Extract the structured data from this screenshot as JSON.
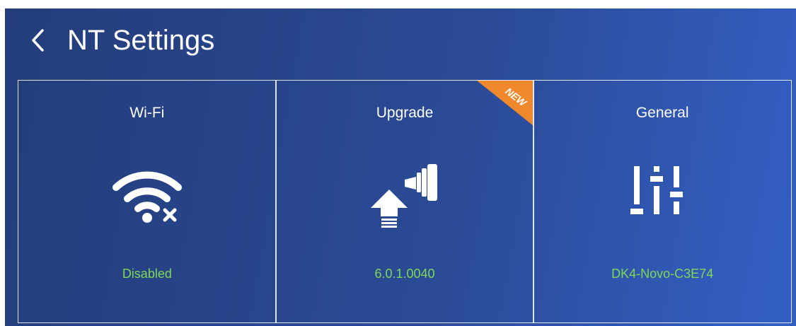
{
  "header": {
    "title": "NT Settings"
  },
  "theme": {
    "status_color": "#7ed957",
    "badge_color": "#f0892e"
  },
  "cards": [
    {
      "title": "Wi-Fi",
      "status": "Disabled",
      "icon": "wifi-off-icon"
    },
    {
      "title": "Upgrade",
      "status": "6.0.1.0040",
      "icon": "upgrade-icon",
      "badge": "NEW"
    },
    {
      "title": "General",
      "status": "DK4-Novo-C3E74",
      "icon": "sliders-icon"
    }
  ]
}
